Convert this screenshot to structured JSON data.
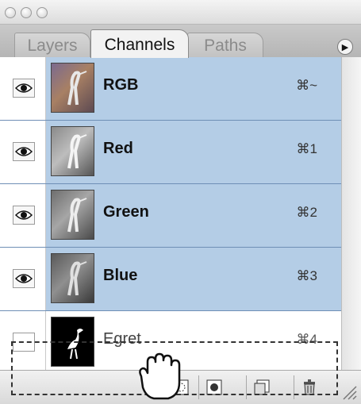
{
  "tabs": {
    "layers": "Layers",
    "channels": "Channels",
    "paths": "Paths"
  },
  "menu_icon": "triangle-right-icon",
  "channels": [
    {
      "name": "RGB",
      "shortcut": "⌘~",
      "visible": true,
      "selected": true
    },
    {
      "name": "Red",
      "shortcut": "⌘1",
      "visible": true,
      "selected": true
    },
    {
      "name": "Green",
      "shortcut": "⌘2",
      "visible": true,
      "selected": true
    },
    {
      "name": "Blue",
      "shortcut": "⌘3",
      "visible": true,
      "selected": true
    },
    {
      "name": "Egret",
      "shortcut": "⌘4",
      "visible": false,
      "selected": false
    }
  ],
  "bottom_buttons": [
    "load-selection-icon",
    "save-selection-icon",
    "new-channel-icon",
    "trash-icon"
  ],
  "colors": {
    "selected_row": "#b4cde6",
    "row_divider": "#6f8fb6"
  }
}
